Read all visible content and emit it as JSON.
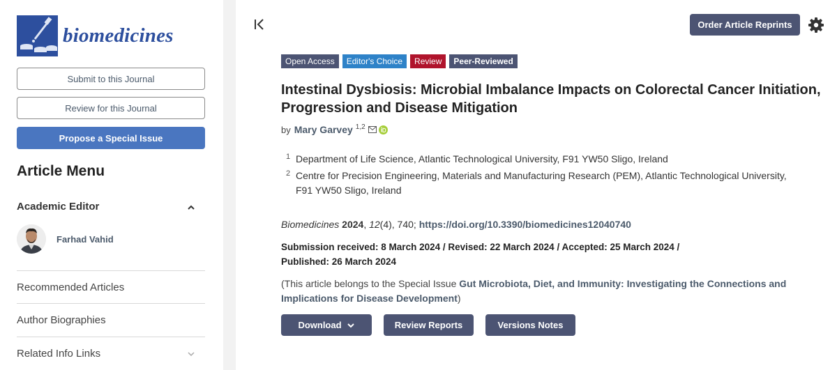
{
  "journal": {
    "name": "biomedicines"
  },
  "sidebar": {
    "submit_label": "Submit to this Journal",
    "review_label": "Review for this Journal",
    "propose_label": "Propose a Special Issue",
    "article_menu_title": "Article Menu",
    "academic_editor_label": "Academic Editor",
    "editor_name": "Farhad Vahid",
    "menu_items": [
      {
        "label": "Recommended Articles"
      },
      {
        "label": "Author Biographies"
      },
      {
        "label": "Related Info Links"
      }
    ]
  },
  "header": {
    "reprints_label": "Order Article Reprints"
  },
  "article": {
    "badges": [
      "Open Access",
      "Editor's Choice",
      "Review",
      "Peer-Reviewed"
    ],
    "title": "Intestinal Dysbiosis: Microbial Imbalance Impacts on Colorectal Cancer Initiation, Progression and Disease Mitigation",
    "by_label": "by",
    "author": "Mary Garvey",
    "author_affiliations": "1,2",
    "affiliations": [
      {
        "num": "1",
        "text": "Department of Life Science, Atlantic Technological University, F91 YW50 Sligo, Ireland"
      },
      {
        "num": "2",
        "text": "Centre for Precision Engineering, Materials and Manufacturing Research (PEM), Atlantic Technological University, F91 YW50 Sligo, Ireland"
      }
    ],
    "citation": {
      "journal": "Biomedicines",
      "year": "2024",
      "volume": "12",
      "issue_pages": "(4), 740;",
      "doi": "https://doi.org/10.3390/biomedicines12040740"
    },
    "dates": "Submission received: 8 March 2024 / Revised: 22 March 2024 / Accepted: 25 March 2024 / Published: 26 March 2024",
    "special_issue": {
      "prefix": "(This article belongs to the Special Issue ",
      "link": "Gut Microbiota, Diet, and Immunity: Investigating the Connections and Implications for Disease Development",
      "suffix": ")"
    },
    "actions": {
      "download_label": "Download",
      "review_reports_label": "Review Reports",
      "versions_notes_label": "Versions Notes"
    }
  },
  "colors": {
    "accent": "#4c5473",
    "brand": "#2d4f9e",
    "editors_choice": "#2e82c8",
    "review": "#b0142c",
    "orcid": "#a6ce39"
  }
}
